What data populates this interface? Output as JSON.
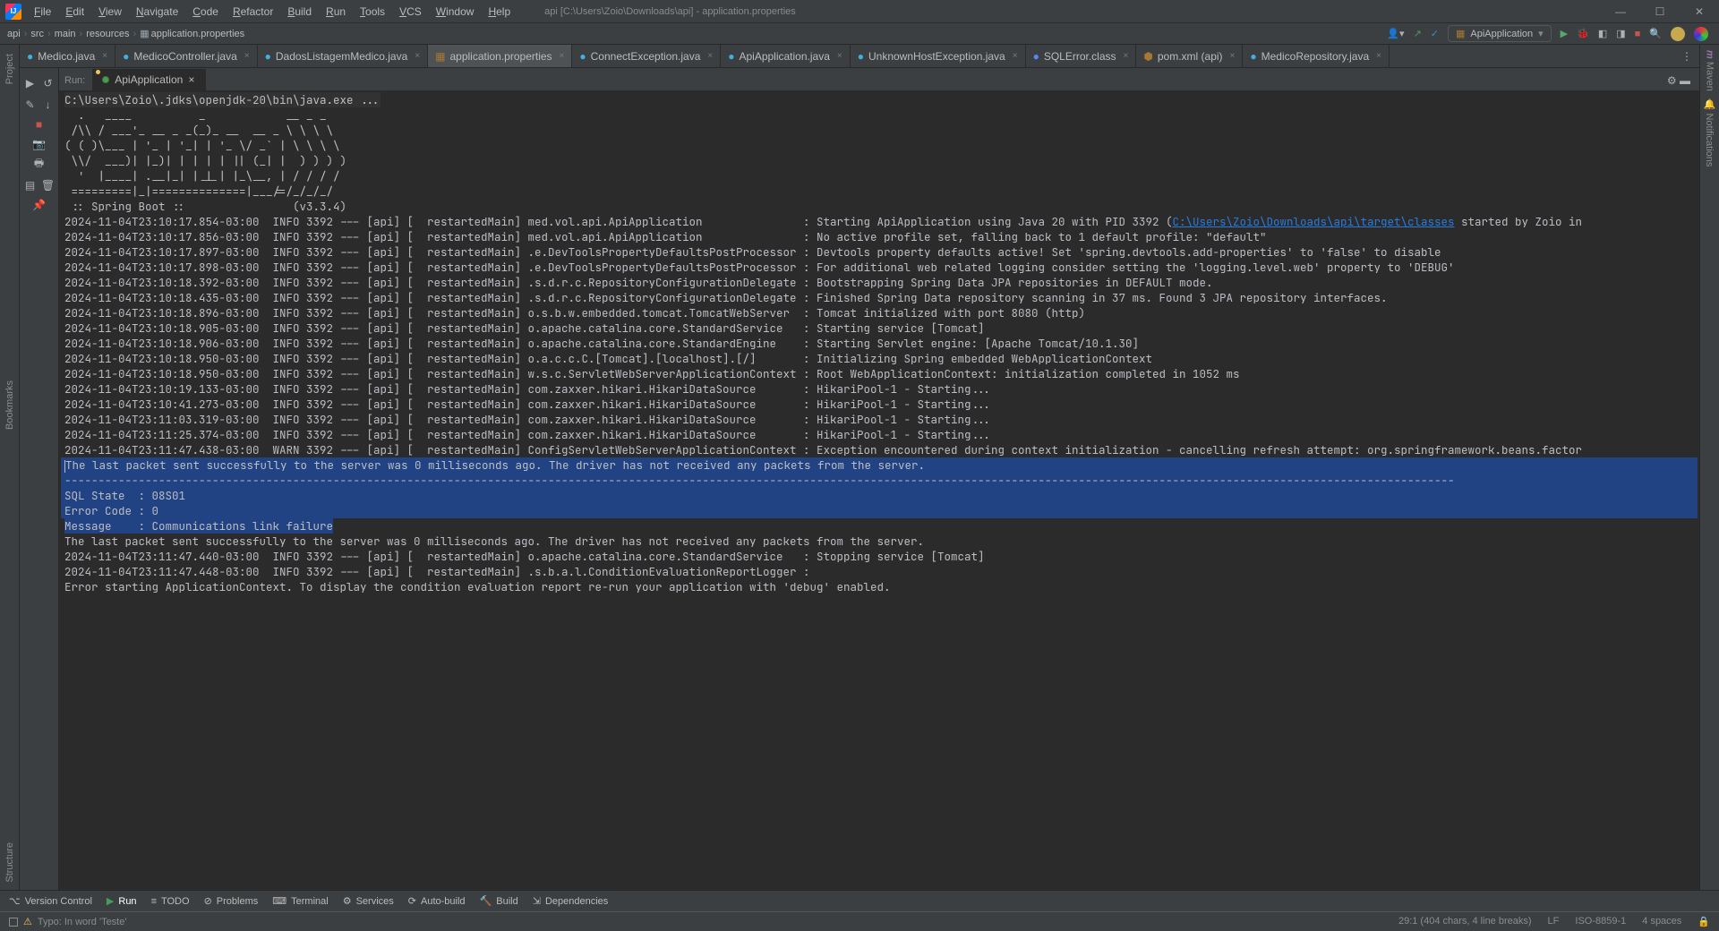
{
  "window": {
    "title": "api [C:\\Users\\Zoio\\Downloads\\api] - application.properties",
    "menus": [
      "File",
      "Edit",
      "View",
      "Navigate",
      "Code",
      "Refactor",
      "Build",
      "Run",
      "Tools",
      "VCS",
      "Window",
      "Help"
    ]
  },
  "breadcrumbs": [
    "api",
    "src",
    "main",
    "resources",
    "application.properties"
  ],
  "toolbar_right": {
    "run_config": "ApiApplication"
  },
  "tabs": [
    {
      "label": "Medico.java",
      "type": "java",
      "active": false
    },
    {
      "label": "MedicoController.java",
      "type": "java",
      "active": false
    },
    {
      "label": "DadosListagemMedico.java",
      "type": "java",
      "active": false
    },
    {
      "label": "application.properties",
      "type": "prop",
      "active": true
    },
    {
      "label": "ConnectException.java",
      "type": "java",
      "active": false
    },
    {
      "label": "ApiApplication.java",
      "type": "java",
      "active": false
    },
    {
      "label": "UnknownHostException.java",
      "type": "java",
      "active": false
    },
    {
      "label": "SQLError.class",
      "type": "class",
      "active": false
    },
    {
      "label": "pom.xml (api)",
      "type": "xml",
      "active": false
    },
    {
      "label": "MedicoRepository.java",
      "type": "java",
      "active": false
    }
  ],
  "run": {
    "label": "Run:",
    "tab": "ApiApplication"
  },
  "sidebars": {
    "left_top": "Project",
    "left_bottom1": "Bookmarks",
    "left_bottom2": "Structure",
    "right_top": "Maven",
    "right_next": "Notifications"
  },
  "console": {
    "prelude": "C:\\Users\\Zoio\\.jdks\\openjdk-20\\bin\\java.exe ...",
    "banner": [
      "  .   ____          _            __ _ _",
      " /\\\\ / ___'_ __ _ _(_)_ __  __ _ \\ \\ \\ \\",
      "( ( )\\___ | '_ | '_| | '_ \\/ _` | \\ \\ \\ \\",
      " \\\\/  ___)| |_)| | | | | || (_| |  ) ) ) )",
      "  '  |____| .__|_| |_|_| |_\\__, | / / / /",
      " =========|_|==============|___/=/_/_/_/"
    ],
    "spring_line": " :: Spring Boot ::                (v3.3.4)",
    "logs": [
      "2024-11-04T23:10:17.854-03:00  INFO 3392 --- [api] [  restartedMain] med.vol.api.ApiApplication               : Starting ApiApplication using Java 20 with PID 3392 (|LINK|C:\\Users\\Zoio\\Downloads\\api\\target\\classes|/LINK| started by Zoio in",
      "2024-11-04T23:10:17.856-03:00  INFO 3392 --- [api] [  restartedMain] med.vol.api.ApiApplication               : No active profile set, falling back to 1 default profile: \"default\"",
      "2024-11-04T23:10:17.897-03:00  INFO 3392 --- [api] [  restartedMain] .e.DevToolsPropertyDefaultsPostProcessor : Devtools property defaults active! Set 'spring.devtools.add-properties' to 'false' to disable",
      "2024-11-04T23:10:17.898-03:00  INFO 3392 --- [api] [  restartedMain] .e.DevToolsPropertyDefaultsPostProcessor : For additional web related logging consider setting the 'logging.level.web' property to 'DEBUG'",
      "2024-11-04T23:10:18.392-03:00  INFO 3392 --- [api] [  restartedMain] .s.d.r.c.RepositoryConfigurationDelegate : Bootstrapping Spring Data JPA repositories in DEFAULT mode.",
      "2024-11-04T23:10:18.435-03:00  INFO 3392 --- [api] [  restartedMain] .s.d.r.c.RepositoryConfigurationDelegate : Finished Spring Data repository scanning in 37 ms. Found 3 JPA repository interfaces.",
      "2024-11-04T23:10:18.896-03:00  INFO 3392 --- [api] [  restartedMain] o.s.b.w.embedded.tomcat.TomcatWebServer  : Tomcat initialized with port 8080 (http)",
      "2024-11-04T23:10:18.905-03:00  INFO 3392 --- [api] [  restartedMain] o.apache.catalina.core.StandardService   : Starting service [Tomcat]",
      "2024-11-04T23:10:18.906-03:00  INFO 3392 --- [api] [  restartedMain] o.apache.catalina.core.StandardEngine    : Starting Servlet engine: [Apache Tomcat/10.1.30]",
      "2024-11-04T23:10:18.950-03:00  INFO 3392 --- [api] [  restartedMain] o.a.c.c.C.[Tomcat].[localhost].[/]       : Initializing Spring embedded WebApplicationContext",
      "2024-11-04T23:10:18.950-03:00  INFO 3392 --- [api] [  restartedMain] w.s.c.ServletWebServerApplicationContext : Root WebApplicationContext: initialization completed in 1052 ms",
      "2024-11-04T23:10:19.133-03:00  INFO 3392 --- [api] [  restartedMain] com.zaxxer.hikari.HikariDataSource       : HikariPool-1 - Starting...",
      "2024-11-04T23:10:41.273-03:00  INFO 3392 --- [api] [  restartedMain] com.zaxxer.hikari.HikariDataSource       : HikariPool-1 - Starting...",
      "2024-11-04T23:11:03.319-03:00  INFO 3392 --- [api] [  restartedMain] com.zaxxer.hikari.HikariDataSource       : HikariPool-1 - Starting...",
      "2024-11-04T23:11:25.374-03:00  INFO 3392 --- [api] [  restartedMain] com.zaxxer.hikari.HikariDataSource       : HikariPool-1 - Starting...",
      "2024-11-04T23:11:47.438-03:00  WARN 3392 --- [api] [  restartedMain] ConfigServletWebServerApplicationContext : Exception encountered during context initialization - cancelling refresh attempt: org.springframework.beans.factor"
    ],
    "selected": [
      "The last packet sent successfully to the server was 0 milliseconds ago. The driver has not received any packets from the server.",
      "---------------------------------------------------------------------------------------------------------------------------------------------------------------------------------------------------------------",
      "SQL State  : 08S01",
      "Error Code : 0"
    ],
    "selected_partial": "Message    : Communications link failure",
    "after": [
      "",
      "The last packet sent successfully to the server was 0 milliseconds ago. The driver has not received any packets from the server.",
      "",
      "2024-11-04T23:11:47.440-03:00  INFO 3392 --- [api] [  restartedMain] o.apache.catalina.core.StandardService   : Stopping service [Tomcat]",
      "2024-11-04T23:11:47.448-03:00  INFO 3392 --- [api] [  restartedMain] .s.b.a.l.ConditionEvaluationReportLogger :",
      "",
      "Error starting ApplicationContext. To display the condition evaluation report re-run your application with 'debug' enabled."
    ]
  },
  "bottom_tools": [
    {
      "icon": "branch",
      "label": "Version Control"
    },
    {
      "icon": "run",
      "label": "Run",
      "active": true
    },
    {
      "icon": "todo",
      "label": "TODO"
    },
    {
      "icon": "problems",
      "label": "Problems"
    },
    {
      "icon": "terminal",
      "label": "Terminal"
    },
    {
      "icon": "services",
      "label": "Services"
    },
    {
      "icon": "autobuild",
      "label": "Auto-build"
    },
    {
      "icon": "build",
      "label": "Build"
    },
    {
      "icon": "deps",
      "label": "Dependencies"
    }
  ],
  "status": {
    "left": "Typo: In word 'Teste'",
    "caret": "29:1 (404 chars, 4 line breaks)",
    "eol": "LF",
    "enc": "ISO-8859-1",
    "indent": "4 spaces"
  }
}
